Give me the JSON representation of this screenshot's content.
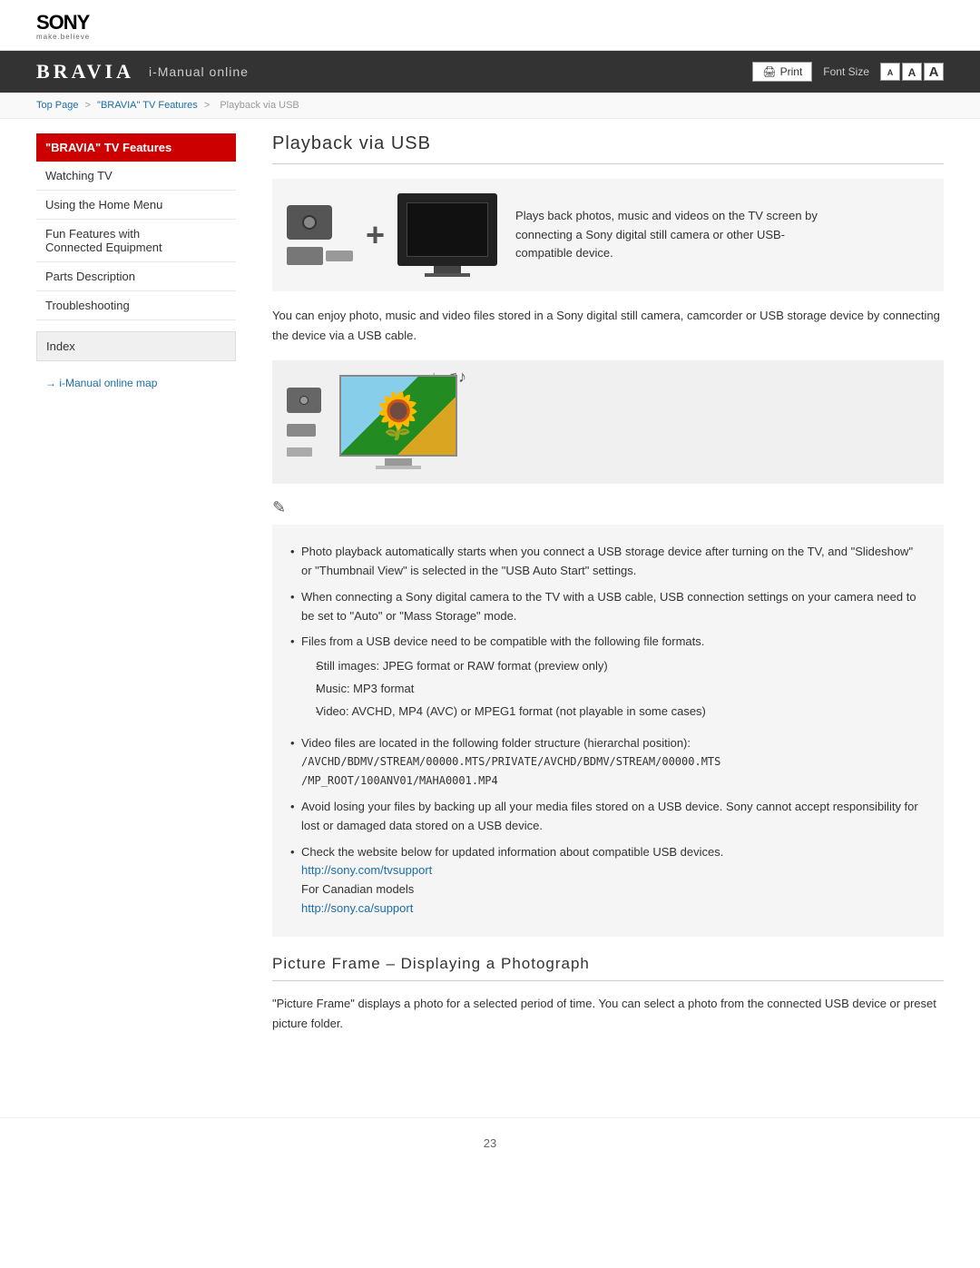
{
  "header": {
    "sony_logo": "SONY",
    "sony_tagline": "make.believe",
    "bravia_logo": "BRAVIA",
    "bravia_subtitle": "i-Manual online",
    "print_label": "Print",
    "font_size_label": "Font Size",
    "font_small": "A",
    "font_medium": "A",
    "font_large": "A"
  },
  "breadcrumb": {
    "top_page": "Top Page",
    "separator1": ">",
    "bravia_features": "\"BRAVIA\" TV Features",
    "separator2": ">",
    "current": "Playback via USB"
  },
  "sidebar": {
    "items": [
      {
        "label": "\"BRAVIA\" TV Features",
        "active": true
      },
      {
        "label": "Watching TV",
        "active": false
      },
      {
        "label": "Using the Home Menu",
        "active": false
      },
      {
        "label": "Fun Features with\nConnected Equipment",
        "active": false
      },
      {
        "label": "Parts Description",
        "active": false
      },
      {
        "label": "Troubleshooting",
        "active": false
      }
    ],
    "index_label": "Index",
    "manual_map_link": "i-Manual online map"
  },
  "content": {
    "page_title": "Playback via USB",
    "top_description": "Plays back photos, music and videos on the TV screen by connecting a Sony digital still camera or other USB-compatible device.",
    "desc_paragraph": "You can enjoy photo, music and video files stored in a Sony digital still camera, camcorder or USB storage device by connecting the device via a USB cable.",
    "notes_section": {
      "bullets": [
        "Photo playback automatically starts when you connect a USB storage device after turning on the TV, and \"Slideshow\" or \"Thumbnail View\" is selected in the \"USB Auto Start\" settings.",
        "When connecting a Sony digital camera to the TV with a USB cable, USB connection settings on your camera need to be set to \"Auto\" or \"Mass Storage\" mode.",
        "Files from a USB device need to be compatible with the following file formats.",
        "Video files are located in the following folder structure (hierarchal position):\n/AVCHD/BDMV/STREAM/00000.MTS/PRIVATE/AVCHD/BDMV/STREAM/00000.MTS\n/MP_ROOT/100ANV01/MAHA0001.MP4",
        "Avoid losing your files by backing up all your media files stored on a USB device. Sony cannot accept responsibility for lost or damaged data stored on a USB device.",
        "Check the website below for updated information about compatible USB devices."
      ],
      "sub_bullets": [
        "Still images: JPEG format or RAW format (preview only)",
        "Music: MP3 format",
        "Video: AVCHD, MP4 (AVC) or MPEG1 format (not playable in some cases)"
      ],
      "link1": "http://sony.com/tvsupport",
      "canadian_label": "For Canadian models",
      "link2": "http://sony.ca/support"
    },
    "section2_title": "Picture Frame – Displaying a Photograph",
    "section2_desc": "\"Picture Frame\" displays a photo for a selected period of time. You can select a photo from the connected USB device or preset picture folder."
  },
  "footer": {
    "page_number": "23"
  }
}
